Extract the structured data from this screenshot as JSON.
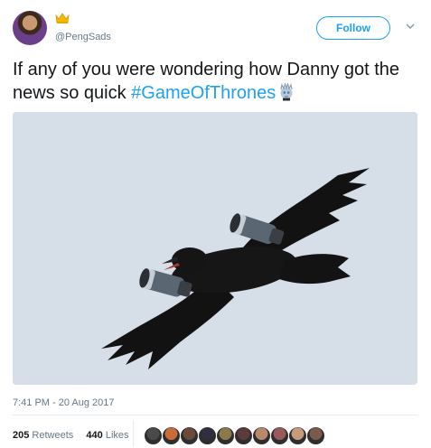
{
  "user": {
    "handle": "@PengSads",
    "avatar_icon": "avatar-image",
    "badge_icon": "crown-icon"
  },
  "actions": {
    "follow_label": "Follow",
    "more_icon": "chevron-down-icon"
  },
  "tweet": {
    "text": "If any of you were wondering how Danny got the news so quick ",
    "hashtag": "#GameOfThrones",
    "emoji": "night-king-emoji",
    "image": "raven-with-jet-engines-photo",
    "timestamp": "7:41 PM - 20 Aug 2017"
  },
  "stats": {
    "retweets_count": "205",
    "retweets_label": "Retweets",
    "likes_count": "440",
    "likes_label": "Likes",
    "liker_colors": [
      "#4a4a4a",
      "#c86c3a",
      "#6a4a3a",
      "#2f2f3f",
      "#8a7a4a",
      "#5a3a3a",
      "#b88a6a",
      "#9a5a5a",
      "#c69a7a",
      "#7a5a4a"
    ]
  },
  "colors": {
    "accent": "#1da1f2",
    "text": "#14171a",
    "muted": "#657786",
    "border": "#e6ecf0"
  }
}
